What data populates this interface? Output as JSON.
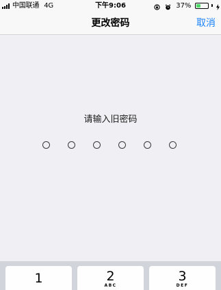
{
  "status_bar": {
    "carrier": "中国联通",
    "network": "4G",
    "time": "下午9:06",
    "battery_percent": "37%",
    "battery_level": 0.37,
    "battery_color": "#4cd964",
    "icons": [
      "signal-icon",
      "rotation-lock-icon",
      "alarm-icon",
      "battery-icon",
      "charging-icon"
    ]
  },
  "nav": {
    "title": "更改密码",
    "cancel_label": "取消",
    "accent_color": "#1a82fb"
  },
  "passcode": {
    "prompt": "请输入旧密码",
    "digits_total": 6,
    "digits_entered": 0
  },
  "keypad": {
    "keys": [
      {
        "digit": "1",
        "letters": ""
      },
      {
        "digit": "2",
        "letters": "ABC"
      },
      {
        "digit": "3",
        "letters": "DEF"
      }
    ]
  }
}
